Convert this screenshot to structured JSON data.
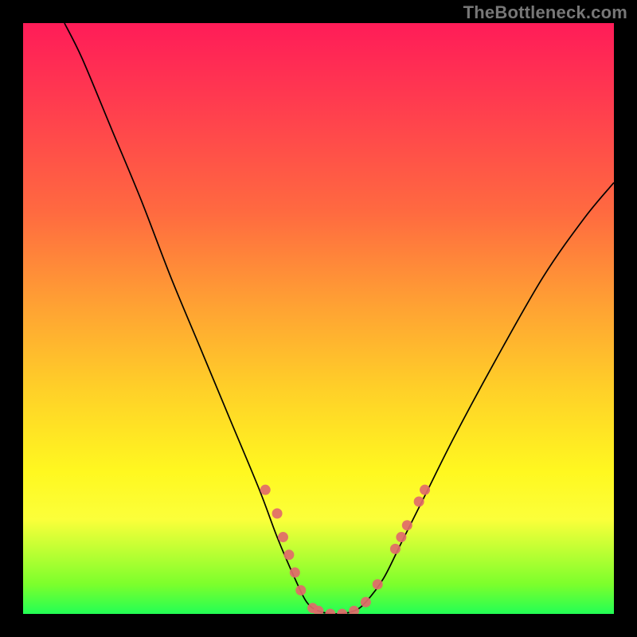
{
  "attribution": {
    "text": "TheBottleneck.com"
  },
  "chart_data": {
    "type": "line",
    "title": "",
    "xlabel": "",
    "ylabel": "",
    "xlim": [
      0,
      100
    ],
    "ylim": [
      0,
      100
    ],
    "grid": false,
    "legend": false,
    "curve": [
      {
        "x": 7,
        "y": 100
      },
      {
        "x": 10,
        "y": 94
      },
      {
        "x": 15,
        "y": 82
      },
      {
        "x": 20,
        "y": 70
      },
      {
        "x": 25,
        "y": 57
      },
      {
        "x": 30,
        "y": 45
      },
      {
        "x": 35,
        "y": 33
      },
      {
        "x": 40,
        "y": 21
      },
      {
        "x": 43,
        "y": 13
      },
      {
        "x": 46,
        "y": 6
      },
      {
        "x": 48,
        "y": 2
      },
      {
        "x": 50,
        "y": 0.5
      },
      {
        "x": 53,
        "y": 0
      },
      {
        "x": 56,
        "y": 0.5
      },
      {
        "x": 58,
        "y": 2
      },
      {
        "x": 61,
        "y": 6
      },
      {
        "x": 64,
        "y": 12
      },
      {
        "x": 68,
        "y": 20
      },
      {
        "x": 73,
        "y": 30
      },
      {
        "x": 80,
        "y": 43
      },
      {
        "x": 88,
        "y": 57
      },
      {
        "x": 95,
        "y": 67
      },
      {
        "x": 100,
        "y": 73
      }
    ],
    "markers": [
      {
        "x": 41,
        "y": 21
      },
      {
        "x": 43,
        "y": 17
      },
      {
        "x": 44,
        "y": 13
      },
      {
        "x": 45,
        "y": 10
      },
      {
        "x": 46,
        "y": 7
      },
      {
        "x": 47,
        "y": 4
      },
      {
        "x": 49,
        "y": 1
      },
      {
        "x": 50,
        "y": 0.5
      },
      {
        "x": 52,
        "y": 0
      },
      {
        "x": 54,
        "y": 0
      },
      {
        "x": 56,
        "y": 0.5
      },
      {
        "x": 58,
        "y": 2
      },
      {
        "x": 60,
        "y": 5
      },
      {
        "x": 63,
        "y": 11
      },
      {
        "x": 64,
        "y": 13
      },
      {
        "x": 65,
        "y": 15
      },
      {
        "x": 67,
        "y": 19
      },
      {
        "x": 68,
        "y": 21
      }
    ],
    "gradient_stops": [
      {
        "pos": 0,
        "color": "#ff1c58"
      },
      {
        "pos": 32,
        "color": "#ff6a40"
      },
      {
        "pos": 62,
        "color": "#ffd028"
      },
      {
        "pos": 84,
        "color": "#fbff3a"
      },
      {
        "pos": 100,
        "color": "#22ff55"
      }
    ]
  }
}
